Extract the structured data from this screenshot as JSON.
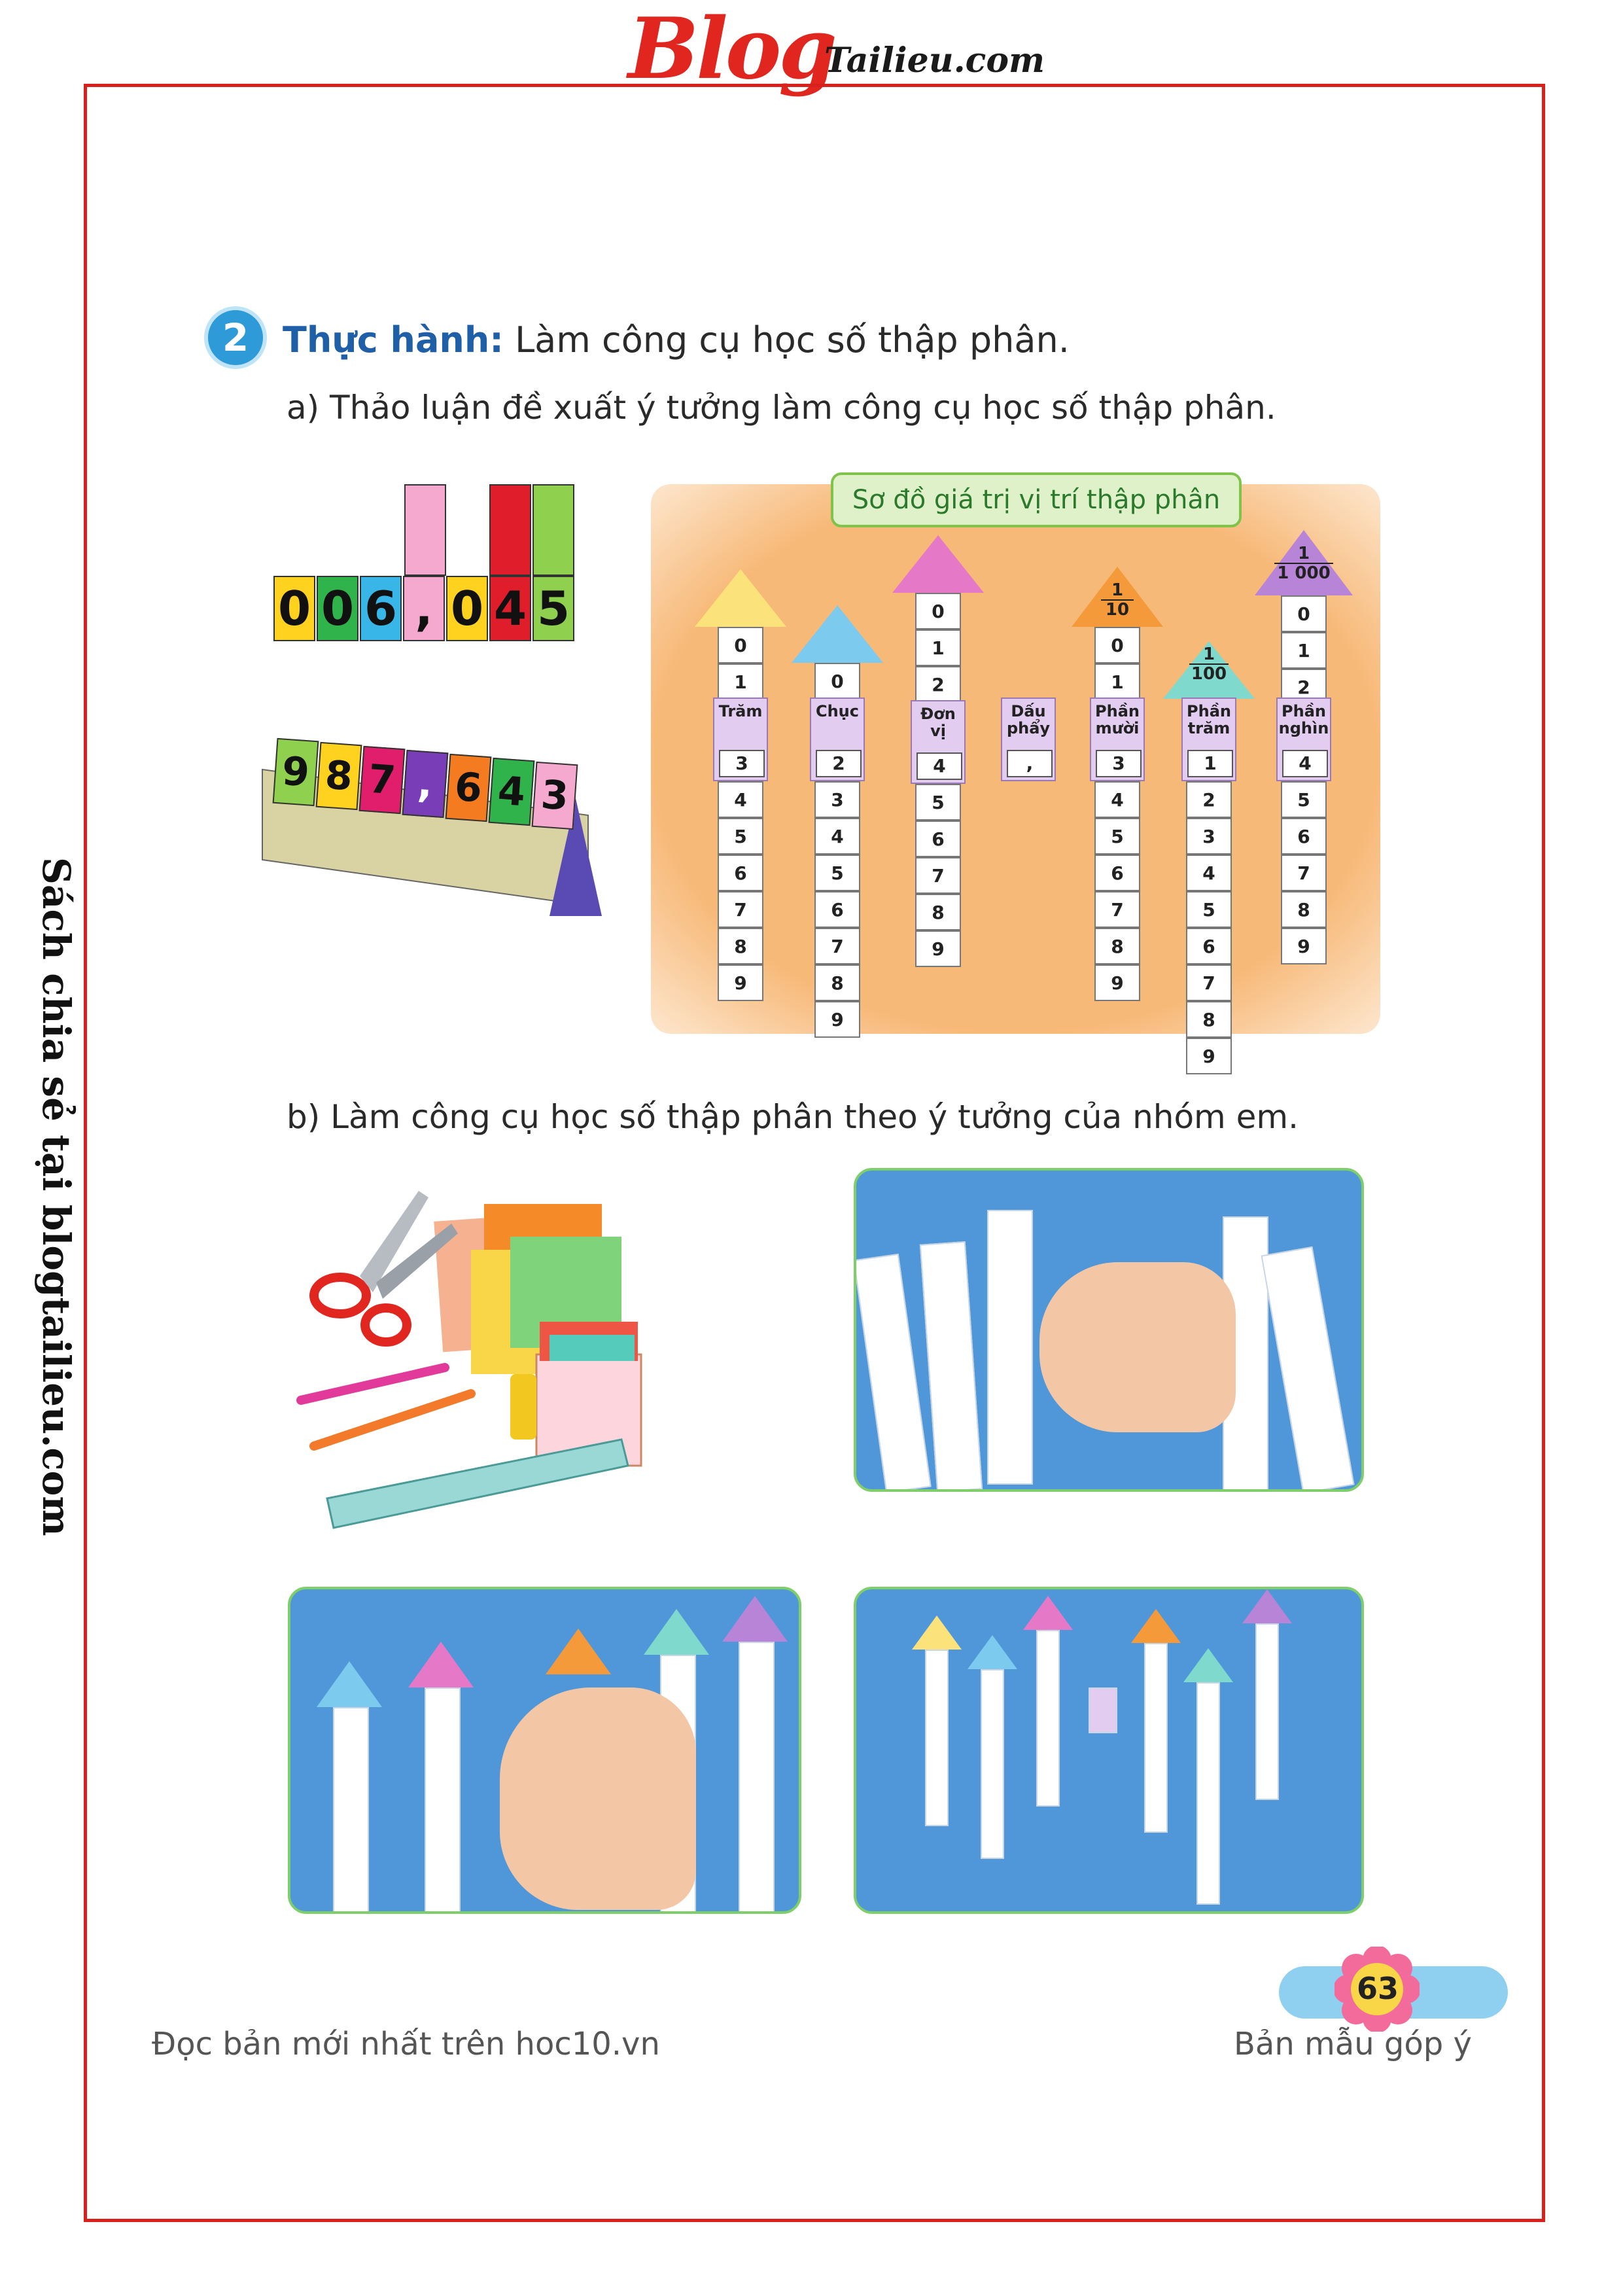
{
  "header": {
    "logo_main": "Blog",
    "logo_sub": "Tailieu.com"
  },
  "side_text": "Sách chia sẻ tại blogtailieu.com",
  "section": {
    "number": "2",
    "title_bold": "Thực hành:",
    "title_rest": " Làm công cụ học số thập phân.",
    "part_a": "a) Thảo luận đề xuất ý tưởng làm công cụ học số thập phân.",
    "part_b": "b) Làm công cụ học số thập phân theo ý tưởng của nhóm em."
  },
  "card_number_1": [
    "0",
    "0",
    "6",
    ",",
    "0",
    "4",
    "5"
  ],
  "card_number_2": [
    "9",
    "8",
    "7",
    ",",
    "6",
    "4",
    "3"
  ],
  "chart": {
    "title": "Sơ đồ giá trị vị trí thập phân",
    "fractions": {
      "tenth": [
        "1",
        "10"
      ],
      "hundredth": [
        "1",
        "100"
      ],
      "thousandth": [
        "1",
        "1 000"
      ]
    },
    "columns": [
      {
        "label": "Trăm",
        "value": "3",
        "digits": [
          "0",
          "1",
          "4",
          "5",
          "6",
          "7",
          "8",
          "9"
        ]
      },
      {
        "label": "Chục",
        "value": "2",
        "digits": [
          "0",
          "3",
          "4",
          "5",
          "6",
          "7",
          "8",
          "9"
        ]
      },
      {
        "label": "Đơn vị",
        "value": "4",
        "digits": [
          "0",
          "1",
          "2",
          "5",
          "6",
          "7",
          "8",
          "9"
        ]
      },
      {
        "label": "Dấu phẩy",
        "value": ","
      },
      {
        "label": "Phần mười",
        "value": "3",
        "digits": [
          "0",
          "1",
          "4",
          "5",
          "6",
          "7",
          "8",
          "9"
        ]
      },
      {
        "label": "Phần trăm",
        "value": "1",
        "digits": [
          "2",
          "3",
          "4",
          "5",
          "6",
          "7",
          "8",
          "9"
        ]
      },
      {
        "label": "Phần nghìn",
        "value": "4",
        "digits": [
          "0",
          "1",
          "2",
          "5",
          "6",
          "7",
          "8",
          "9"
        ]
      }
    ]
  },
  "footer": {
    "left": "Đọc bản mới nhất trên hoc10.vn",
    "right": "Bản mẫu góp ý",
    "page": "63"
  },
  "colors": {
    "frame": "#d8211c",
    "accent": "#2f9ad8",
    "chart_bg": "#f7b978"
  }
}
